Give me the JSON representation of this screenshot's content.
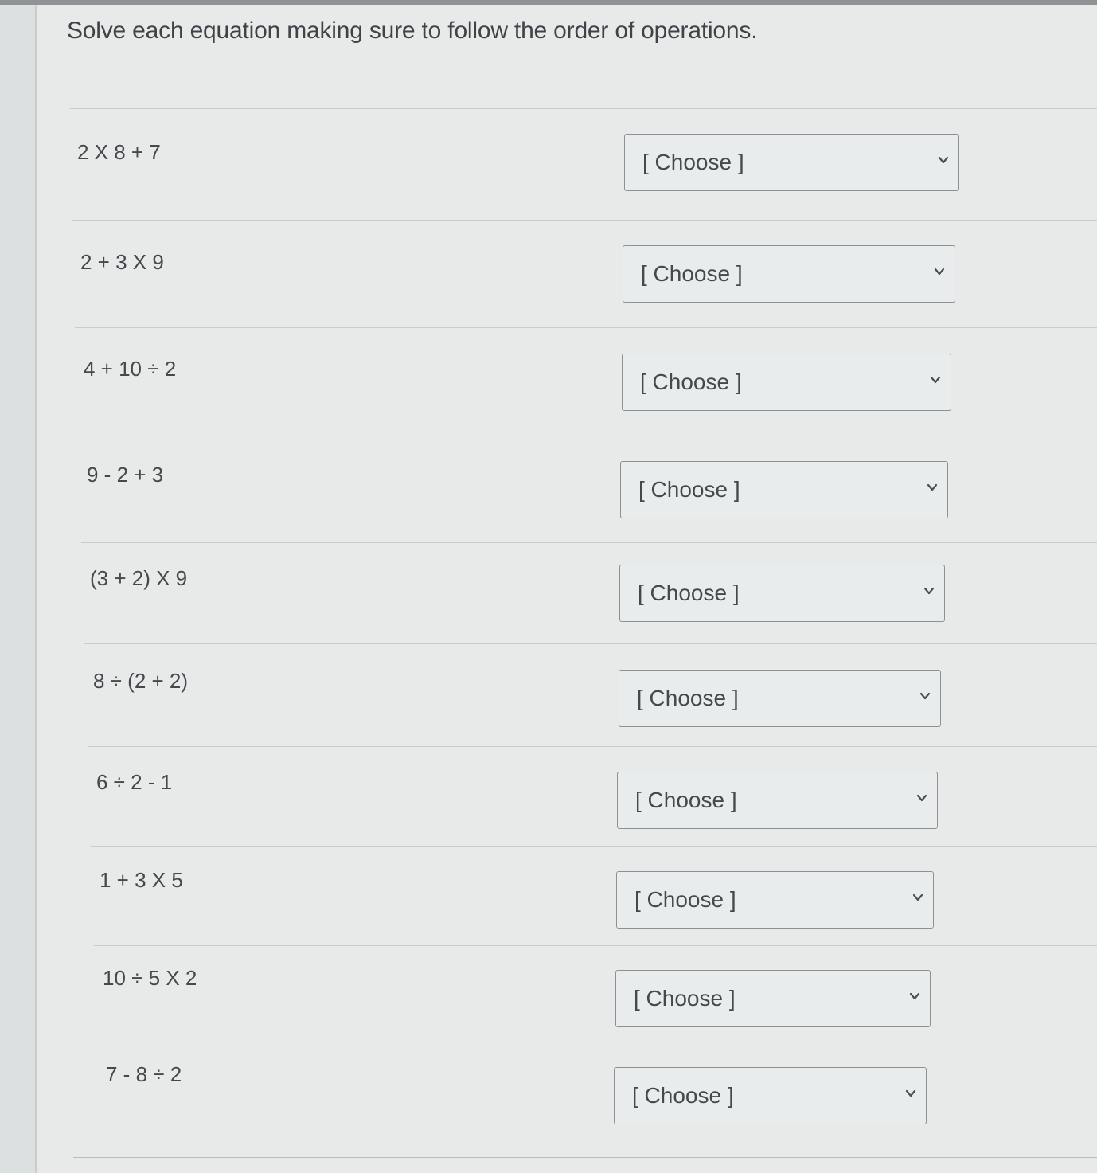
{
  "instructions": "Solve each equation making sure to follow the order of operations.",
  "placeholder": "[ Choose ]",
  "questions": [
    {
      "prompt": "2 X 8 + 7",
      "selected": "[ Choose ]"
    },
    {
      "prompt": "2 + 3 X 9",
      "selected": "[ Choose ]"
    },
    {
      "prompt": "4 + 10 ÷ 2",
      "selected": "[ Choose ]"
    },
    {
      "prompt": "9 - 2 + 3",
      "selected": "[ Choose ]"
    },
    {
      "prompt": "(3 + 2) X 9",
      "selected": "[ Choose ]"
    },
    {
      "prompt": "8 ÷ (2 + 2)",
      "selected": "[ Choose ]"
    },
    {
      "prompt": "6 ÷ 2 - 1",
      "selected": "[ Choose ]"
    },
    {
      "prompt": "1 + 3 X 5",
      "selected": "[ Choose ]"
    },
    {
      "prompt": "10 ÷ 5 X 2",
      "selected": "[ Choose ]"
    },
    {
      "prompt": "7 - 8 ÷ 2",
      "selected": "[ Choose ]"
    }
  ],
  "icons": {
    "dropdown": "chevron-down-icon"
  }
}
